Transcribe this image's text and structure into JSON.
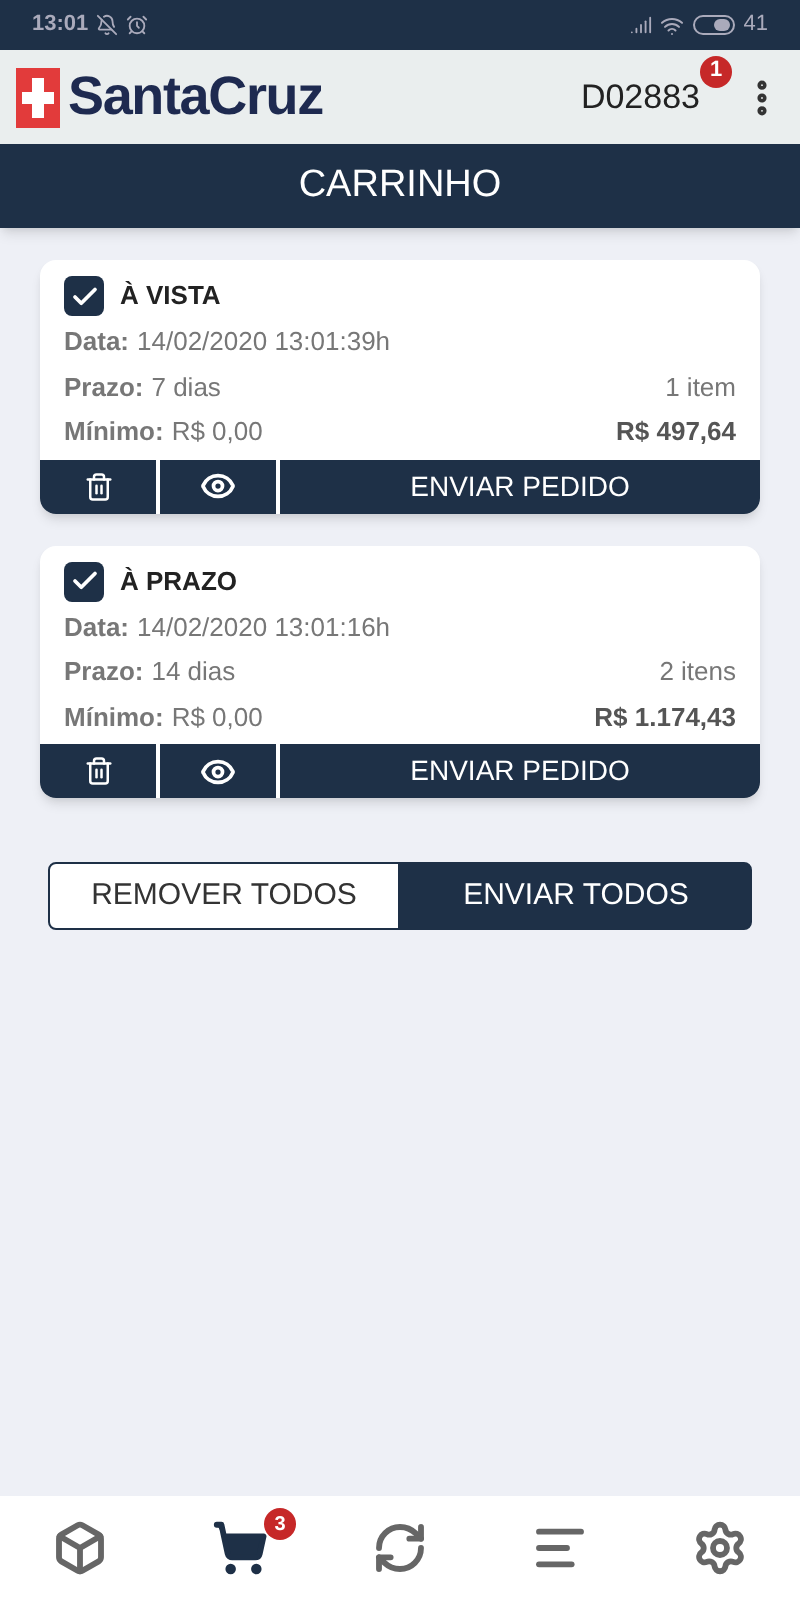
{
  "status_bar": {
    "time": "13:01",
    "battery": "41"
  },
  "header": {
    "brand": "SantaCruz",
    "user": "D02883",
    "user_badge": "1"
  },
  "title": "CARRINHO",
  "orders": [
    {
      "title": "À VISTA",
      "checked": true,
      "data_label": "Data:",
      "data": "14/02/2020 13:01:39h",
      "prazo_label": "Prazo:",
      "prazo": "7 dias",
      "items": "1 item",
      "minimo_label": "Mínimo:",
      "minimo": "R$ 0,00",
      "total": "R$ 497,64",
      "send": "ENVIAR PEDIDO"
    },
    {
      "title": "À PRAZO",
      "checked": true,
      "data_label": "Data:",
      "data": "14/02/2020 13:01:16h",
      "prazo_label": "Prazo:",
      "prazo": "14 dias",
      "items": "2 itens",
      "minimo_label": "Mínimo:",
      "minimo": "R$ 0,00",
      "total": "R$ 1.174,43",
      "send": "ENVIAR PEDIDO"
    }
  ],
  "actions": [
    {
      "label": "REMOVER TODOS",
      "kind": "outline"
    },
    {
      "label": "ENVIAR TODOS",
      "kind": "solid"
    }
  ],
  "bottom_nav": [
    {
      "kind": "products",
      "selected": false
    },
    {
      "kind": "cart",
      "selected": true,
      "badge": "3"
    },
    {
      "kind": "sync",
      "selected": false
    },
    {
      "kind": "list",
      "selected": false
    },
    {
      "kind": "settings",
      "selected": false
    }
  ]
}
